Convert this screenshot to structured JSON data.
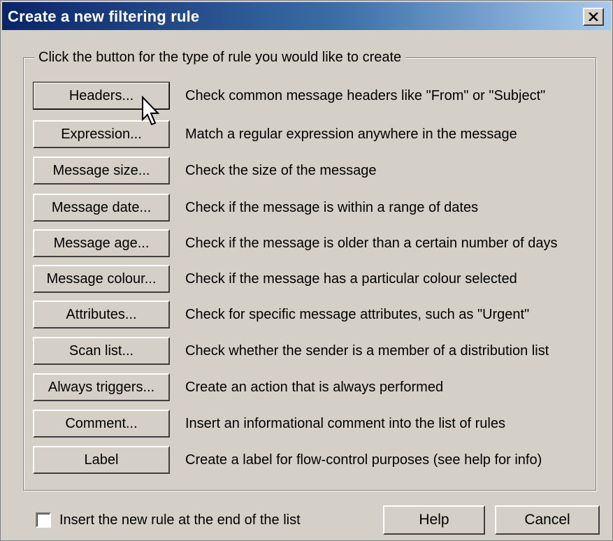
{
  "window": {
    "title": "Create a new filtering rule"
  },
  "group": {
    "label": "Click the button for the type of rule you would like to create"
  },
  "rules": [
    {
      "button": "Headers...",
      "description": "Check common message headers like \"From\" or \"Subject\""
    },
    {
      "button": "Expression...",
      "description": "Match a regular expression anywhere in the message"
    },
    {
      "button": "Message size...",
      "description": "Check the size of the message"
    },
    {
      "button": "Message date...",
      "description": "Check if the message is within a range of dates"
    },
    {
      "button": "Message age...",
      "description": "Check if the message is older than a certain number of days"
    },
    {
      "button": "Message colour...",
      "description": "Check if the message has a particular colour selected"
    },
    {
      "button": "Attributes...",
      "description": "Check for specific message attributes, such as \"Urgent\""
    },
    {
      "button": "Scan list...",
      "description": "Check whether the sender is a member of a distribution list"
    },
    {
      "button": "Always triggers...",
      "description": "Create an action that is always performed"
    },
    {
      "button": "Comment...",
      "description": "Insert an informational comment into the list of rules"
    },
    {
      "button": "Label",
      "description": "Create a label for flow-control purposes (see help for info)"
    }
  ],
  "footer": {
    "checkbox_label": "Insert the new rule at the end of the list",
    "checkbox_checked": false,
    "help_label": "Help",
    "cancel_label": "Cancel"
  },
  "icons": {
    "close": "close-icon",
    "cursor": "mouse-pointer-icon"
  },
  "colors": {
    "titlebar_start": "#0a246a",
    "titlebar_end": "#a6caf0",
    "face": "#d4d0c8"
  }
}
